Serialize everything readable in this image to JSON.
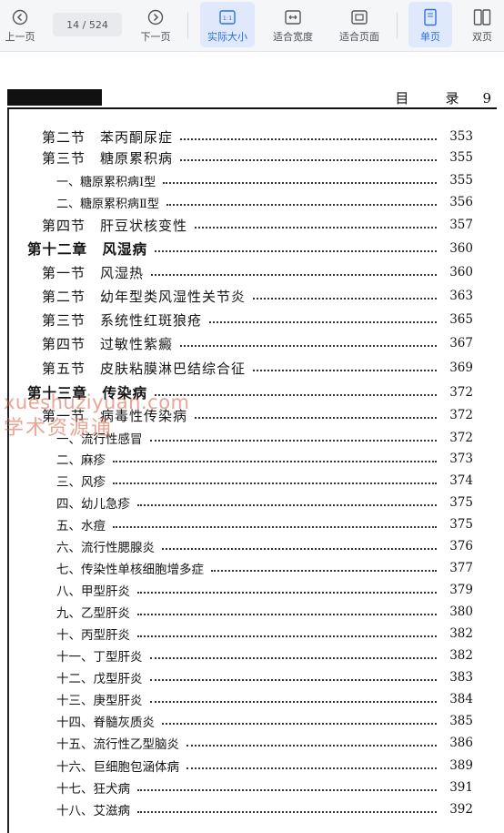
{
  "toolbar": {
    "prev_label": "上一页",
    "page_indicator": "14 / 524",
    "next_label": "下一页",
    "actual_size_label": "实际大小",
    "fit_width_label": "适合宽度",
    "fit_page_label": "适合页面",
    "single_page_label": "单页",
    "double_page_label": "双页",
    "active_color": "#2f6fe0"
  },
  "page_header": {
    "title_part1": "目",
    "title_part2": "录",
    "page_number": "9"
  },
  "toc": [
    {
      "label": "第二节　苯丙酮尿症",
      "page": "353",
      "level": "section"
    },
    {
      "label": "第三节　糖原累积病",
      "page": "355",
      "level": "section"
    },
    {
      "label": "一、糖原累积病Ⅰ型",
      "page": "355",
      "level": "sub"
    },
    {
      "label": "二、糖原累积病Ⅱ型",
      "page": "356",
      "level": "sub"
    },
    {
      "label": "第四节　肝豆状核变性",
      "page": "357",
      "level": "section"
    },
    {
      "label": "第十二章　风湿病",
      "page": "360",
      "level": "chapter"
    },
    {
      "label": "第一节　风湿热",
      "page": "360",
      "level": "section"
    },
    {
      "label": "第二节　幼年型类风湿性关节炎",
      "page": "363",
      "level": "section"
    },
    {
      "label": "第三节　系统性红斑狼疮",
      "page": "365",
      "level": "section"
    },
    {
      "label": "第四节　过敏性紫癜",
      "page": "367",
      "level": "section"
    },
    {
      "label": "第五节　皮肤粘膜淋巴结综合征",
      "page": "369",
      "level": "section"
    },
    {
      "label": "第十三章　传染病",
      "page": "372",
      "level": "chapter"
    },
    {
      "label": "第一节　病毒性传染病",
      "page": "372",
      "level": "section"
    },
    {
      "label": "一、流行性感冒",
      "page": "372",
      "level": "sub2"
    },
    {
      "label": "二、麻疹",
      "page": "373",
      "level": "sub2"
    },
    {
      "label": "三、风疹",
      "page": "374",
      "level": "sub2"
    },
    {
      "label": "四、幼儿急疹",
      "page": "375",
      "level": "sub2"
    },
    {
      "label": "五、水痘",
      "page": "375",
      "level": "sub2"
    },
    {
      "label": "六、流行性腮腺炎",
      "page": "376",
      "level": "sub2"
    },
    {
      "label": "七、传染性单核细胞增多症",
      "page": "377",
      "level": "sub2"
    },
    {
      "label": "八、甲型肝炎",
      "page": "379",
      "level": "sub2"
    },
    {
      "label": "九、乙型肝炎",
      "page": "380",
      "level": "sub2"
    },
    {
      "label": "十、丙型肝炎",
      "page": "382",
      "level": "sub2"
    },
    {
      "label": "十一、丁型肝炎",
      "page": "382",
      "level": "sub2"
    },
    {
      "label": "十二、戊型肝炎",
      "page": "383",
      "level": "sub2"
    },
    {
      "label": "十三、庚型肝炎",
      "page": "384",
      "level": "sub2"
    },
    {
      "label": "十四、脊髓灰质炎",
      "page": "385",
      "level": "sub2"
    },
    {
      "label": "十五、流行性乙型脑炎",
      "page": "386",
      "level": "sub2"
    },
    {
      "label": "十六、巨细胞包涵体病",
      "page": "389",
      "level": "sub2"
    },
    {
      "label": "十七、狂犬病",
      "page": "391",
      "level": "sub2"
    },
    {
      "label": "十八、艾滋病",
      "page": "392",
      "level": "sub2"
    }
  ],
  "watermark": {
    "line1": "xueshuziyuan.com",
    "line2": "学术资源通"
  }
}
